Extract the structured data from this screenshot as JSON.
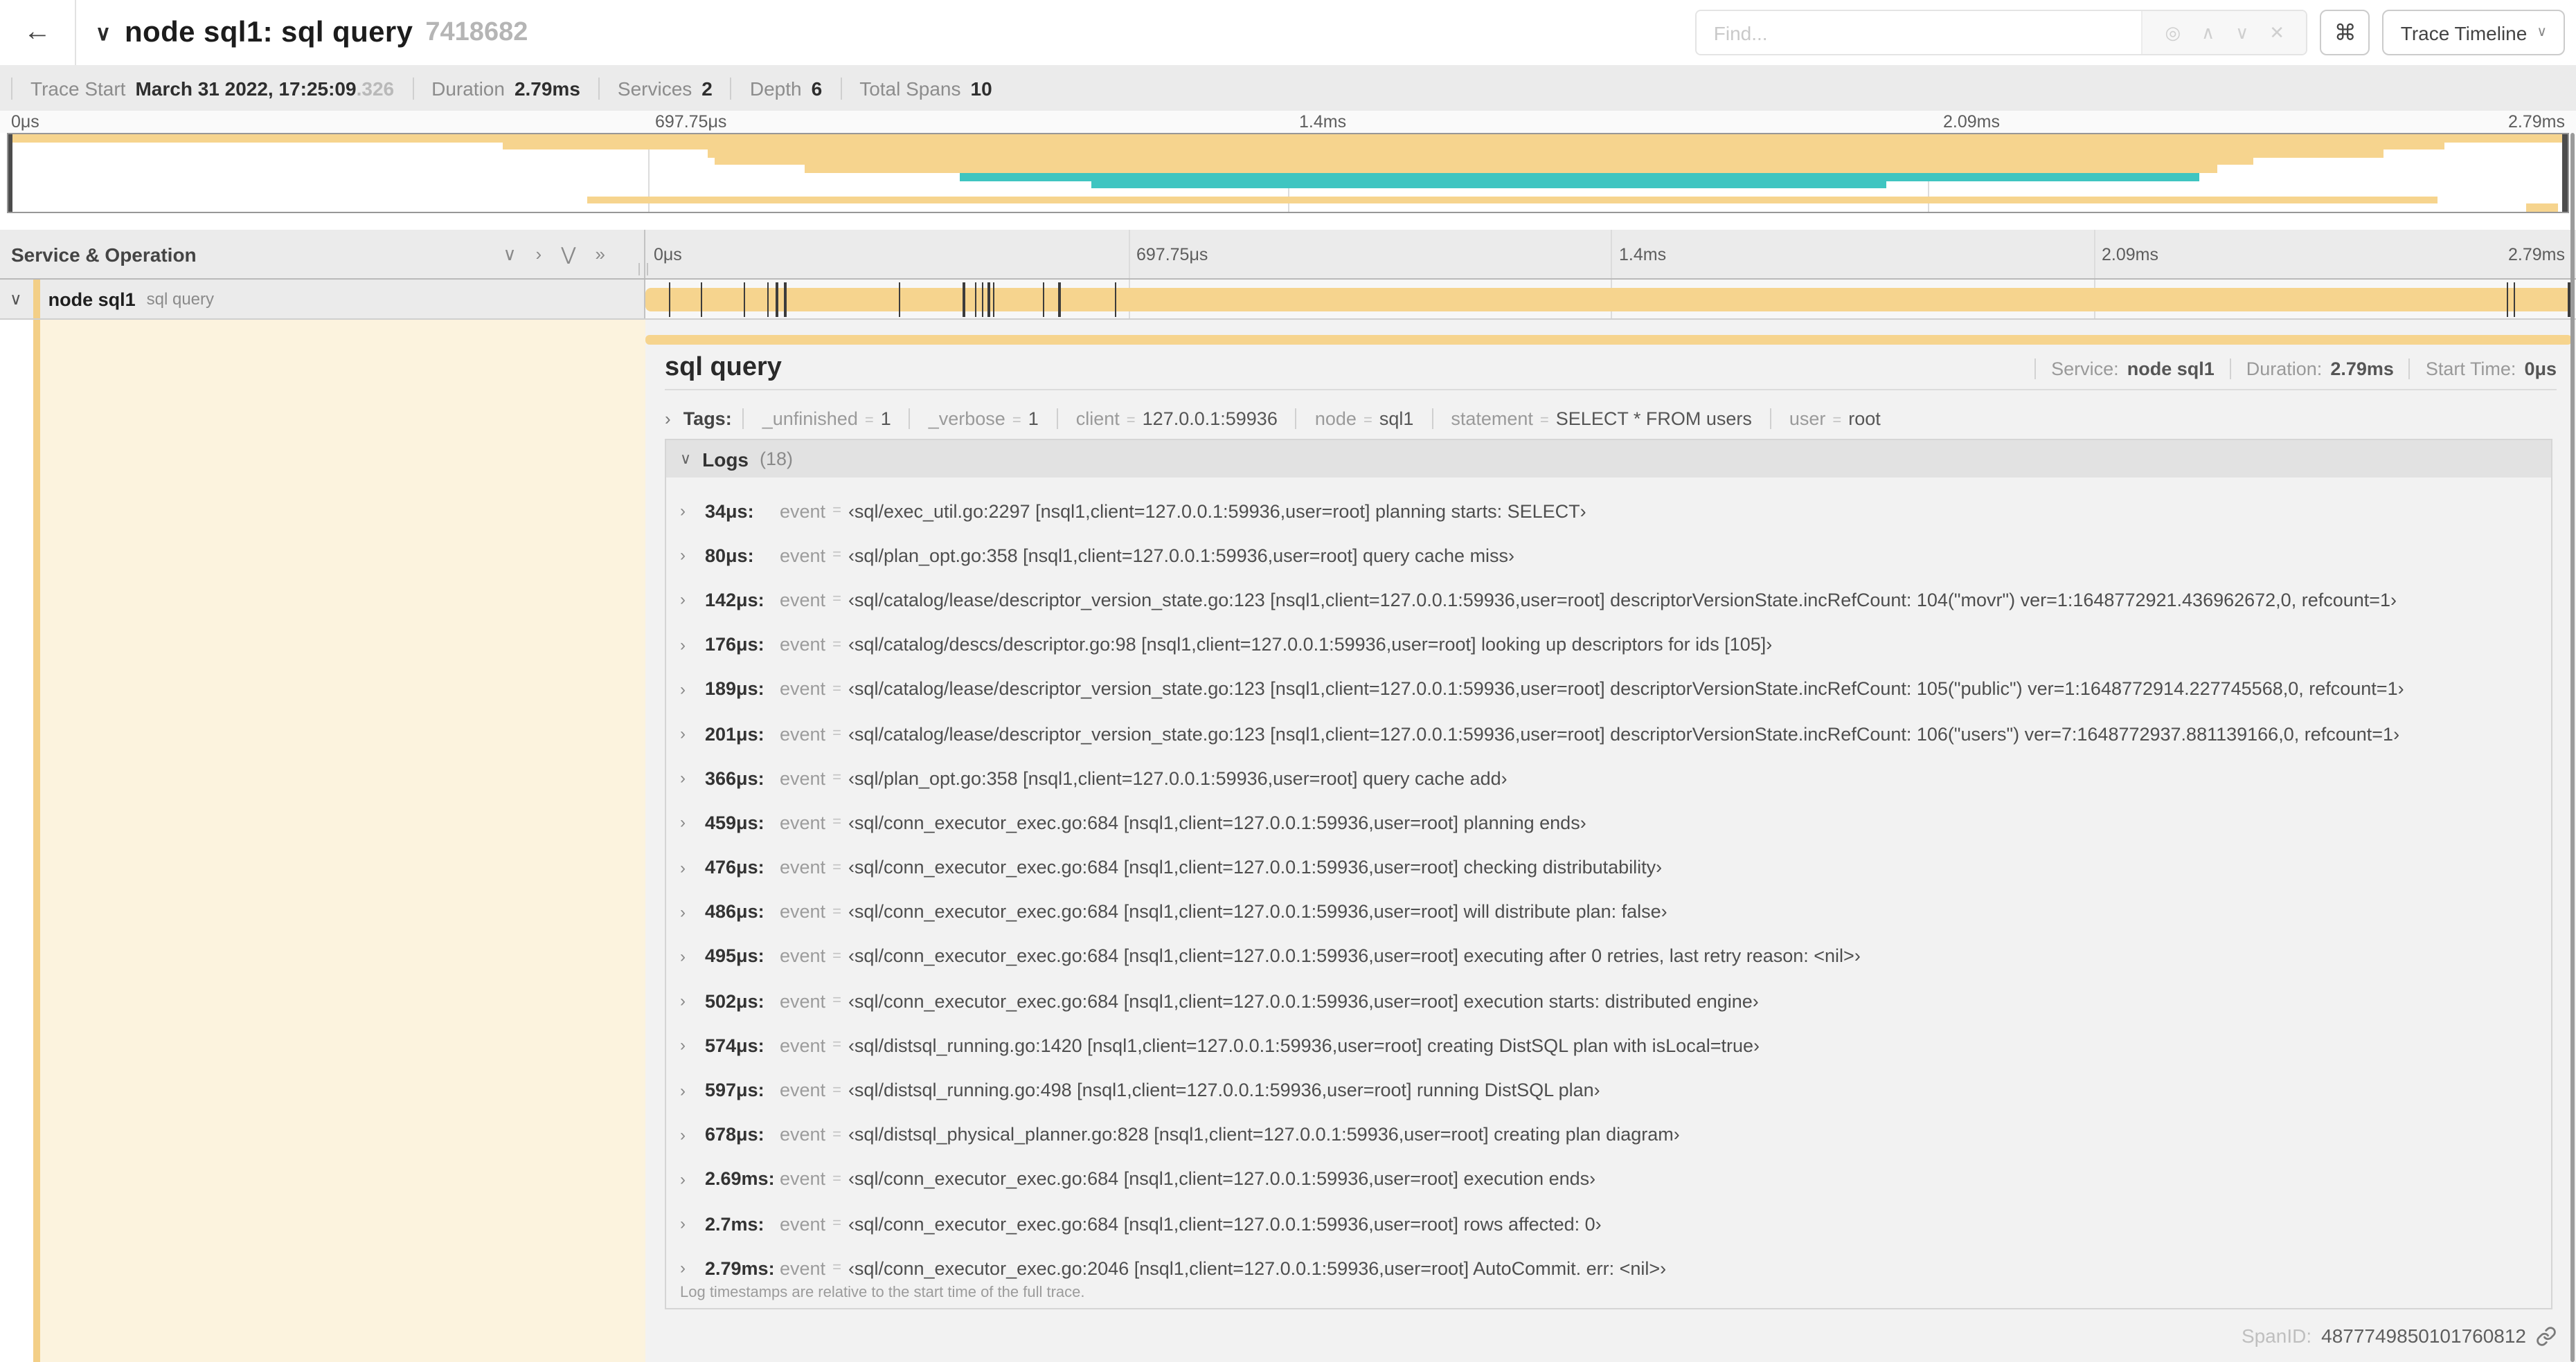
{
  "icons": {
    "back": "←",
    "chevron_down": "∨",
    "chevron_right": "›",
    "double_down": "⋁",
    "double_right": "»",
    "target": "◎",
    "up": "∧",
    "down": "∨",
    "clear": "✕",
    "command": "⌘",
    "caret": "∨",
    "logs_chevron": "∨"
  },
  "colors": {
    "span_tan": "#f6d48e",
    "span_teal": "#3fc5c1",
    "strip_tan": "#f3cf87",
    "cream": "#fcf3de"
  },
  "header": {
    "title": "node sql1: sql query",
    "trace_id": "7418682",
    "find_placeholder": "Find...",
    "view_selector": "Trace Timeline"
  },
  "summary": {
    "items": [
      {
        "label": "Trace Start",
        "value": "March 31 2022, 17:25:09",
        "suffix": ".326"
      },
      {
        "label": "Duration",
        "value": "2.79ms"
      },
      {
        "label": "Services",
        "value": "2"
      },
      {
        "label": "Depth",
        "value": "6"
      },
      {
        "label": "Total Spans",
        "value": "10"
      }
    ]
  },
  "timeline": {
    "column_header": "Service & Operation",
    "ticks": [
      {
        "label": "0μs",
        "pct": 0
      },
      {
        "label": "697.75μs",
        "pct": 25
      },
      {
        "label": "1.4ms",
        "pct": 50
      },
      {
        "label": "2.09ms",
        "pct": 75
      },
      {
        "label": "2.79ms",
        "pct": 100
      }
    ],
    "minimap_spans": [
      {
        "row": 0,
        "start": 0,
        "end": 100,
        "color": "span_tan"
      },
      {
        "row": 1,
        "start": 19.3,
        "end": 95.2,
        "color": "span_tan"
      },
      {
        "row": 2,
        "start": 27.3,
        "end": 92.8,
        "color": "span_tan"
      },
      {
        "row": 3,
        "start": 27.6,
        "end": 87.7,
        "color": "span_tan"
      },
      {
        "row": 4,
        "start": 31.1,
        "end": 86.3,
        "color": "span_tan"
      },
      {
        "row": 5,
        "start": 37.2,
        "end": 85.6,
        "color": "span_teal"
      },
      {
        "row": 6,
        "start": 42.3,
        "end": 73.4,
        "color": "span_teal"
      },
      {
        "row": 8,
        "start": 22.6,
        "end": 94.9,
        "color": "span_tan"
      },
      {
        "row": 9,
        "start": 98.4,
        "end": 99.6,
        "color": "span_tan"
      }
    ],
    "span_row": {
      "service": "node sql1",
      "operation": "sql query",
      "duration_us": 2790,
      "log_marker_us": [
        34,
        80,
        142,
        176,
        189,
        201,
        366,
        459,
        476,
        486,
        495,
        502,
        574,
        597,
        678,
        2690,
        2700,
        2790
      ]
    }
  },
  "detail": {
    "operation": "sql query",
    "equals": "=",
    "meta": [
      {
        "label": "Service:",
        "value": "node sql1"
      },
      {
        "label": "Duration:",
        "value": "2.79ms"
      },
      {
        "label": "Start Time:",
        "value": "0μs"
      }
    ],
    "tags_label": "Tags:",
    "tags": [
      {
        "key": "_unfinished",
        "value": "1"
      },
      {
        "key": "_verbose",
        "value": "1"
      },
      {
        "key": "client",
        "value": "127.0.0.1:59936"
      },
      {
        "key": "node",
        "value": "sql1"
      },
      {
        "key": "statement",
        "value": "SELECT * FROM users"
      },
      {
        "key": "user",
        "value": "root"
      }
    ],
    "logs_label": "Logs",
    "logs_count": "(18)",
    "logs": [
      {
        "time": "34μs:",
        "field": "event",
        "value": "‹sql/exec_util.go:2297 [nsql1,client=127.0.0.1:59936,user=root] planning starts: SELECT›"
      },
      {
        "time": "80μs:",
        "field": "event",
        "value": "‹sql/plan_opt.go:358 [nsql1,client=127.0.0.1:59936,user=root] query cache miss›"
      },
      {
        "time": "142μs:",
        "field": "event",
        "value": "‹sql/catalog/lease/descriptor_version_state.go:123 [nsql1,client=127.0.0.1:59936,user=root] descriptorVersionState.incRefCount: 104(\"movr\") ver=1:1648772921.436962672,0, refcount=1›"
      },
      {
        "time": "176μs:",
        "field": "event",
        "value": "‹sql/catalog/descs/descriptor.go:98 [nsql1,client=127.0.0.1:59936,user=root] looking up descriptors for ids [105]›"
      },
      {
        "time": "189μs:",
        "field": "event",
        "value": "‹sql/catalog/lease/descriptor_version_state.go:123 [nsql1,client=127.0.0.1:59936,user=root] descriptorVersionState.incRefCount: 105(\"public\") ver=1:1648772914.227745568,0, refcount=1›"
      },
      {
        "time": "201μs:",
        "field": "event",
        "value": "‹sql/catalog/lease/descriptor_version_state.go:123 [nsql1,client=127.0.0.1:59936,user=root] descriptorVersionState.incRefCount: 106(\"users\") ver=7:1648772937.881139166,0, refcount=1›"
      },
      {
        "time": "366μs:",
        "field": "event",
        "value": "‹sql/plan_opt.go:358 [nsql1,client=127.0.0.1:59936,user=root] query cache add›"
      },
      {
        "time": "459μs:",
        "field": "event",
        "value": "‹sql/conn_executor_exec.go:684 [nsql1,client=127.0.0.1:59936,user=root] planning ends›"
      },
      {
        "time": "476μs:",
        "field": "event",
        "value": "‹sql/conn_executor_exec.go:684 [nsql1,client=127.0.0.1:59936,user=root] checking distributability›"
      },
      {
        "time": "486μs:",
        "field": "event",
        "value": "‹sql/conn_executor_exec.go:684 [nsql1,client=127.0.0.1:59936,user=root] will distribute plan: false›"
      },
      {
        "time": "495μs:",
        "field": "event",
        "value": "‹sql/conn_executor_exec.go:684 [nsql1,client=127.0.0.1:59936,user=root] executing after 0 retries, last retry reason: <nil>›"
      },
      {
        "time": "502μs:",
        "field": "event",
        "value": "‹sql/conn_executor_exec.go:684 [nsql1,client=127.0.0.1:59936,user=root] execution starts: distributed engine›"
      },
      {
        "time": "574μs:",
        "field": "event",
        "value": "‹sql/distsql_running.go:1420 [nsql1,client=127.0.0.1:59936,user=root] creating DistSQL plan with isLocal=true›"
      },
      {
        "time": "597μs:",
        "field": "event",
        "value": "‹sql/distsql_running.go:498 [nsql1,client=127.0.0.1:59936,user=root] running DistSQL plan›"
      },
      {
        "time": "678μs:",
        "field": "event",
        "value": "‹sql/distsql_physical_planner.go:828 [nsql1,client=127.0.0.1:59936,user=root] creating plan diagram›"
      },
      {
        "time": "2.69ms:",
        "field": "event",
        "value": "‹sql/conn_executor_exec.go:684 [nsql1,client=127.0.0.1:59936,user=root] execution ends›"
      },
      {
        "time": "2.7ms:",
        "field": "event",
        "value": "‹sql/conn_executor_exec.go:684 [nsql1,client=127.0.0.1:59936,user=root] rows affected: 0›"
      },
      {
        "time": "2.79ms:",
        "field": "event",
        "value": "‹sql/conn_executor_exec.go:2046 [nsql1,client=127.0.0.1:59936,user=root] AutoCommit. err: <nil>›"
      }
    ],
    "note": "Log timestamps are relative to the start time of the full trace.",
    "spanid_label": "SpanID:",
    "spanid": "4877749850101760812"
  }
}
